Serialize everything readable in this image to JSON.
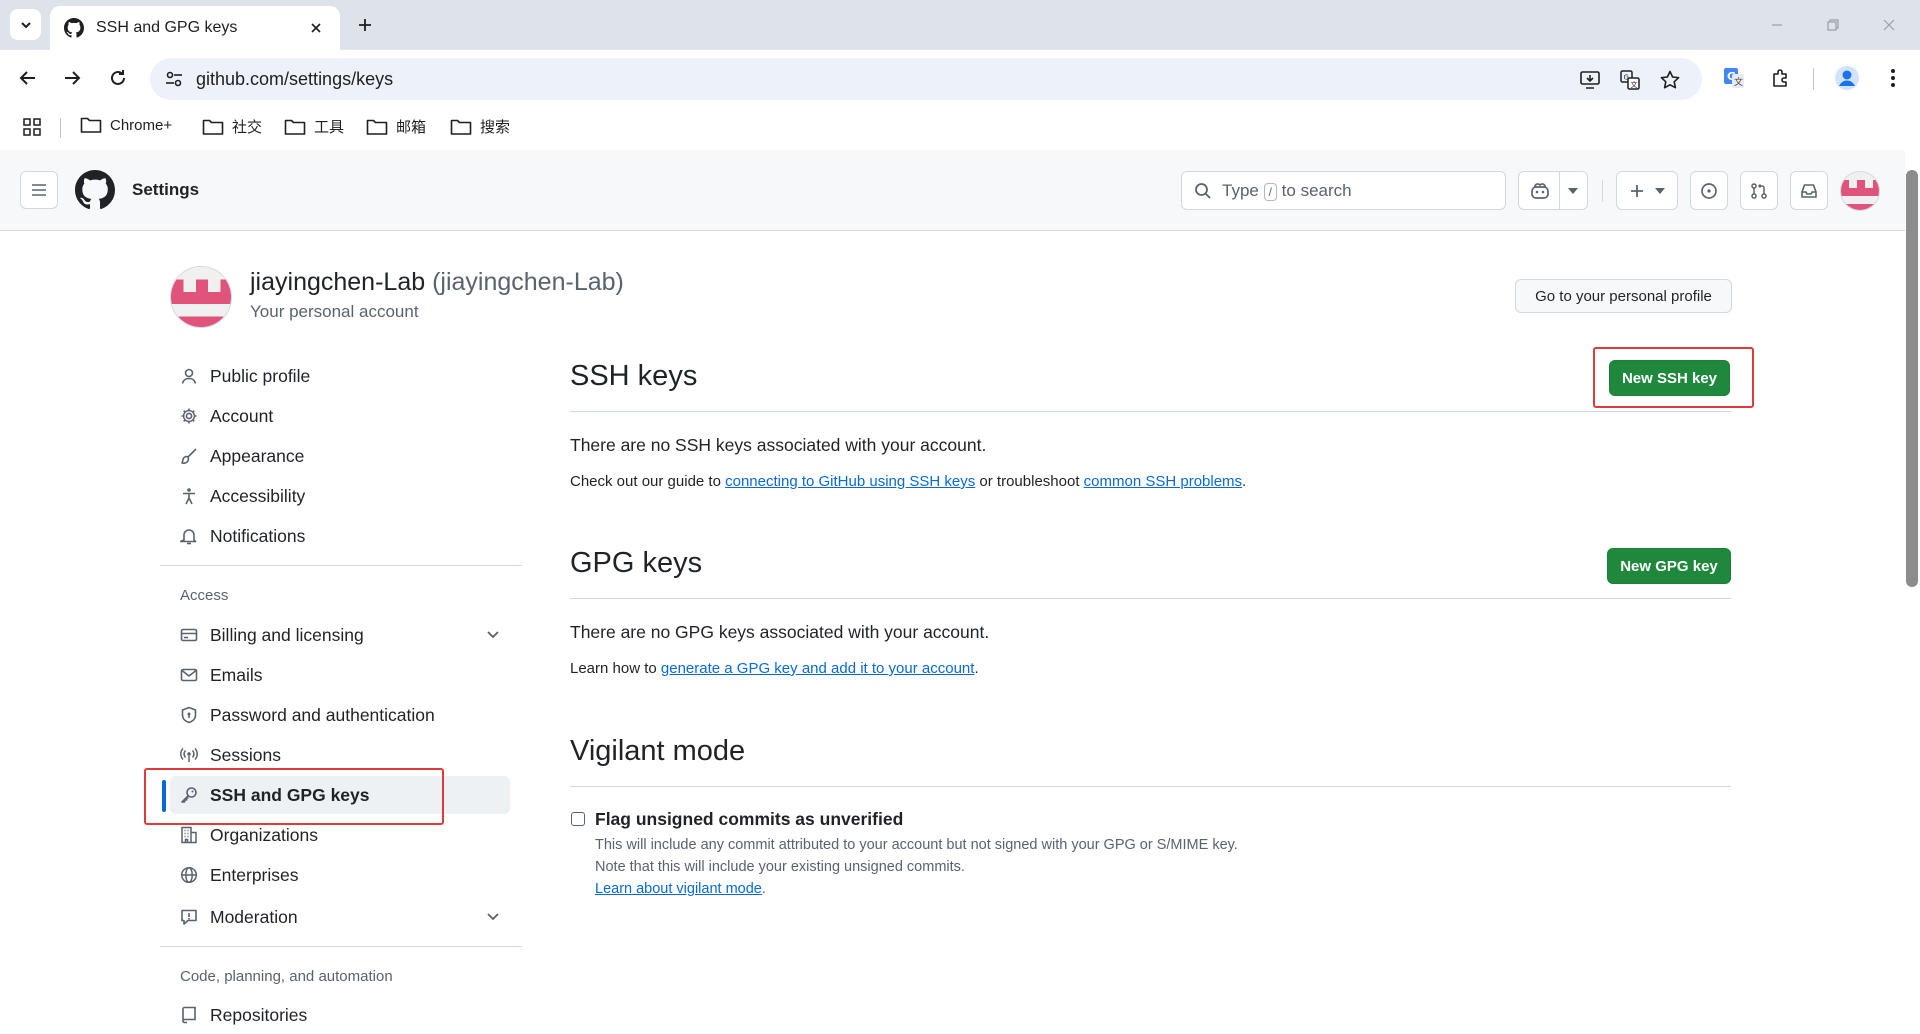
{
  "browser": {
    "tab_title": "SSH and GPG keys",
    "url": "github.com/settings/keys",
    "bookmarks": [
      "Chrome+",
      "社交",
      "工具",
      "邮箱",
      "搜索"
    ]
  },
  "header": {
    "title": "Settings",
    "search_type": "Type",
    "search_key": "/",
    "search_rest": "to search"
  },
  "account": {
    "name": "jiayingchen-Lab",
    "login": "(jiayingchen-Lab)",
    "subtitle": "Your personal account",
    "profile_button": "Go to your personal profile"
  },
  "sidebar": {
    "items": [
      {
        "label": "Public profile",
        "icon": "person-icon"
      },
      {
        "label": "Account",
        "icon": "gear-icon"
      },
      {
        "label": "Appearance",
        "icon": "paintbrush-icon"
      },
      {
        "label": "Accessibility",
        "icon": "accessibility-icon"
      },
      {
        "label": "Notifications",
        "icon": "bell-icon"
      }
    ],
    "access_heading": "Access",
    "access_items": [
      {
        "label": "Billing and licensing",
        "icon": "credit-card-icon"
      },
      {
        "label": "Emails",
        "icon": "mail-icon"
      },
      {
        "label": "Password and authentication",
        "icon": "shield-lock-icon"
      },
      {
        "label": "Sessions",
        "icon": "broadcast-icon"
      },
      {
        "label": "SSH and GPG keys",
        "icon": "key-icon"
      },
      {
        "label": "Organizations",
        "icon": "organization-icon"
      },
      {
        "label": "Enterprises",
        "icon": "globe-icon"
      },
      {
        "label": "Moderation",
        "icon": "report-icon"
      }
    ],
    "code_heading": "Code, planning, and automation",
    "code_items": [
      {
        "label": "Repositories",
        "icon": "repo-icon"
      }
    ]
  },
  "ssh": {
    "title": "SSH keys",
    "button": "New SSH key",
    "empty": "There are no SSH keys associated with your account.",
    "guide_prefix": "Check out our guide to ",
    "guide_link": "connecting to GitHub using SSH keys",
    "guide_mid": " or troubleshoot ",
    "guide_link2": "common SSH problems",
    "guide_end": "."
  },
  "gpg": {
    "title": "GPG keys",
    "button": "New GPG key",
    "empty": "There are no GPG keys associated with your account.",
    "learn_prefix": "Learn how to ",
    "learn_link": "generate a GPG key and add it to your account",
    "learn_end": "."
  },
  "vigilant": {
    "title": "Vigilant mode",
    "checkbox_label": "Flag unsigned commits as unverified",
    "checked": false,
    "note1": "This will include any commit attributed to your account but not signed with your GPG or S/MIME key.",
    "note2": "Note that this will include your existing unsigned commits.",
    "learn_link": "Learn about vigilant mode",
    "learn_end": "."
  },
  "colors": {
    "accent": "#0969da",
    "primary_button": "#1f883d",
    "highlight_box": "#e03a3a",
    "avatar_pink": "#e0537a"
  }
}
